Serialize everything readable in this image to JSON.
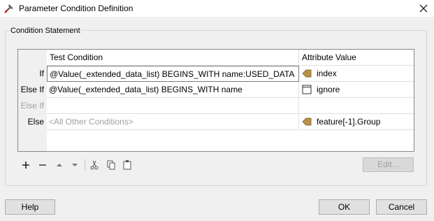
{
  "window": {
    "title": "Parameter Condition Definition",
    "app_icon": "fme-workbench-icon",
    "close_icon": "close-icon"
  },
  "group": {
    "label": "Condition Statement"
  },
  "table": {
    "headers": {
      "test_condition": "Test Condition",
      "attribute_value": "Attribute Value"
    },
    "rows": [
      {
        "label": "If",
        "condition": "@Value(_extended_data_list) BEGINS_WITH name:USED_DATA",
        "value": "index",
        "value_icon": "attribute-arrow-icon"
      },
      {
        "label": "Else If",
        "condition": "@Value(_extended_data_list) BEGINS_WITH name",
        "value": "ignore",
        "value_icon": "constant-box-icon"
      },
      {
        "label": "Else If",
        "condition": "",
        "value": "",
        "value_icon": ""
      },
      {
        "label": "Else",
        "condition": "<All Other Conditions>",
        "value": "feature[-1].Group",
        "value_icon": "attribute-arrow-icon"
      }
    ]
  },
  "toolbar": {
    "icons": [
      "add-icon",
      "remove-icon",
      "move-up-icon",
      "move-down-icon",
      "cut-icon",
      "copy-icon",
      "paste-icon"
    ],
    "edit_label": "Edit..."
  },
  "buttons": {
    "help": "Help",
    "ok": "OK",
    "cancel": "Cancel"
  },
  "colors": {
    "arrow_icon": "#b8924a",
    "window_bg": "#f0f0f0",
    "grid_border": "#828790"
  }
}
